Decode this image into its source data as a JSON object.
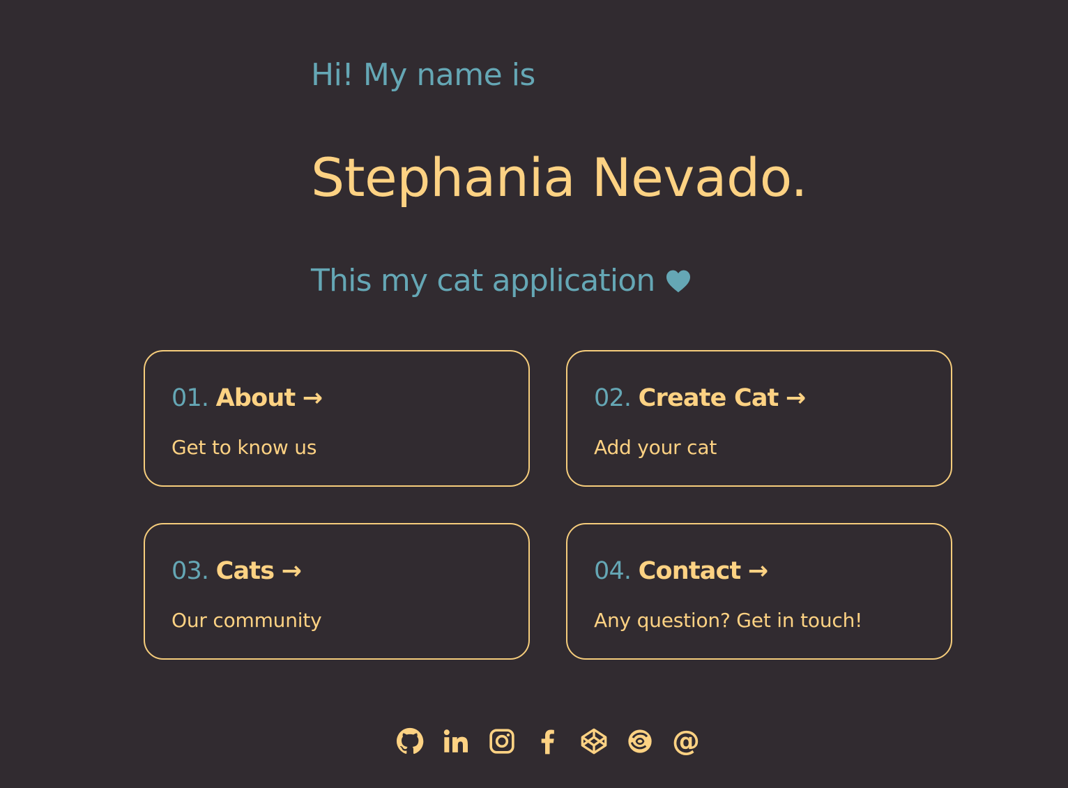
{
  "hero": {
    "greeting": "Hi! My name is",
    "name": "Stephania Nevado.",
    "tagline": "This my cat application",
    "tagline_icon": "heart-icon"
  },
  "cards": [
    {
      "number": "01.",
      "label": "About",
      "arrow": "→",
      "description": "Get to know us"
    },
    {
      "number": "02.",
      "label": "Create Cat",
      "arrow": "→",
      "description": "Add your cat"
    },
    {
      "number": "03.",
      "label": "Cats",
      "arrow": "→",
      "description": "Our community"
    },
    {
      "number": "04.",
      "label": "Contact",
      "arrow": "→",
      "description": "Any question? Get in touch!"
    }
  ],
  "socials": [
    {
      "icon": "github-icon"
    },
    {
      "icon": "linkedin-icon"
    },
    {
      "icon": "instagram-icon"
    },
    {
      "icon": "facebook-icon"
    },
    {
      "icon": "codepen-icon"
    },
    {
      "icon": "codewars-icon"
    },
    {
      "icon": "email-icon",
      "glyph": "@"
    }
  ],
  "colors": {
    "background": "#312b30",
    "accent_yellow": "#fdd283",
    "accent_teal": "#65a7b5",
    "card_border": "#f6cd7c"
  }
}
